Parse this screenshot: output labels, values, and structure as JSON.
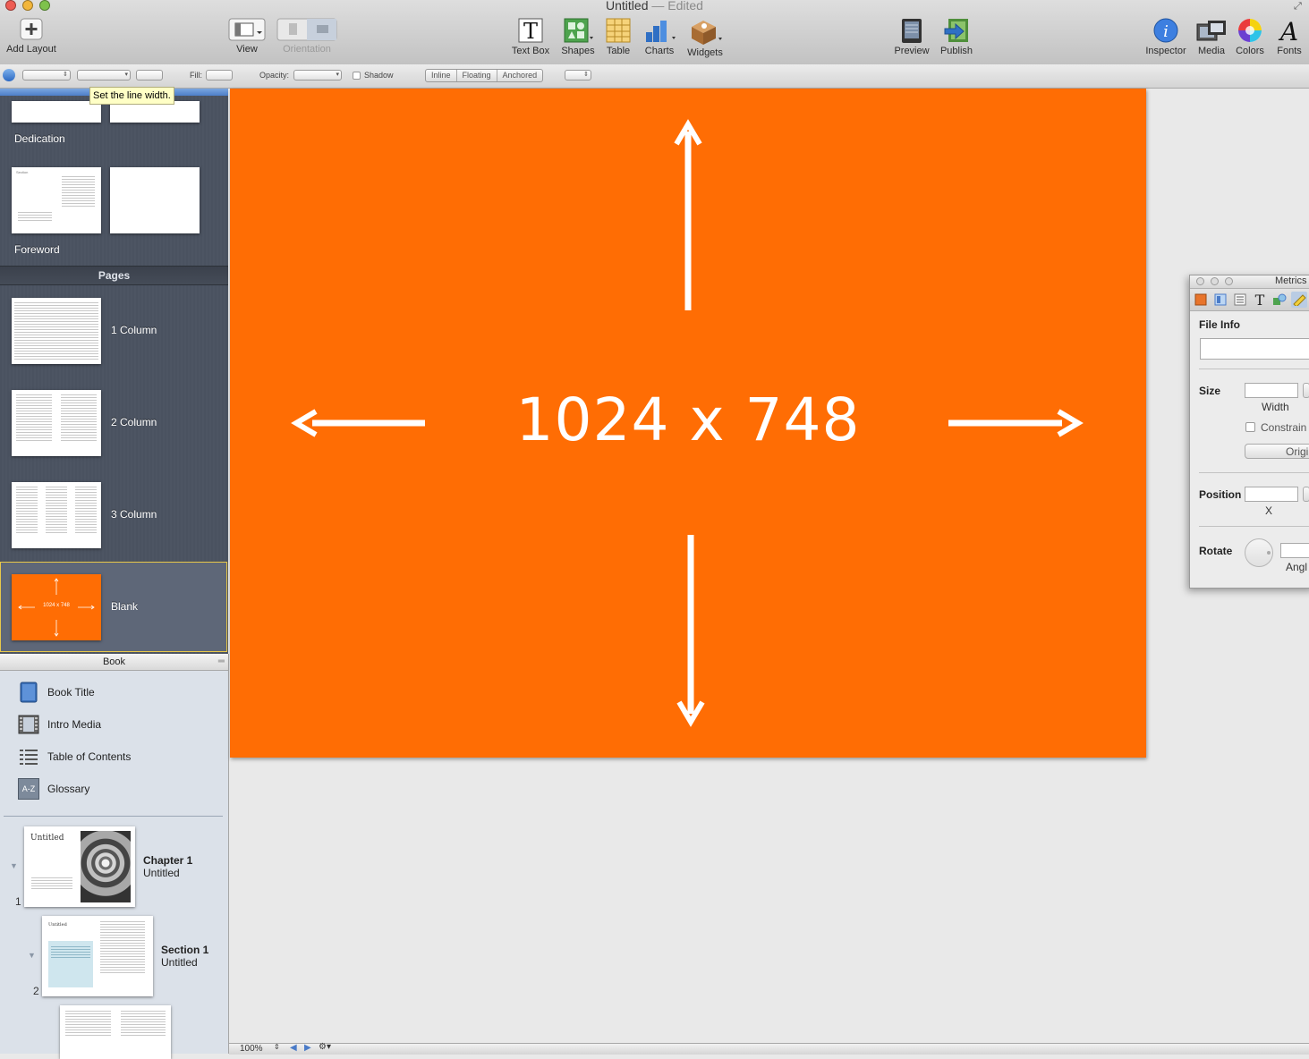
{
  "window": {
    "title": "Untitled",
    "separator": "—",
    "status": "Edited"
  },
  "toolbar": {
    "add_layout": "Add Layout",
    "view": "View",
    "orientation": "Orientation",
    "text_box": "Text Box",
    "shapes": "Shapes",
    "table": "Table",
    "charts": "Charts",
    "widgets": "Widgets",
    "preview": "Preview",
    "publish": "Publish",
    "inspector": "Inspector",
    "media": "Media",
    "colors": "Colors",
    "fonts": "Fonts"
  },
  "format_bar": {
    "fill_label": "Fill:",
    "opacity_label": "Opacity:",
    "shadow_label": "Shadow",
    "wrap_options": [
      "Inline",
      "Floating",
      "Anchored"
    ],
    "tooltip": "Set the line width."
  },
  "layouts": {
    "dedication_label": "Dedication",
    "foreword_label": "Foreword",
    "foreword_thumb_heading": "Section",
    "pages_header": "Pages",
    "pages": [
      "1 Column",
      "2 Column",
      "3 Column",
      "Blank"
    ],
    "blank_thumb_caption": "1024 x 748"
  },
  "book": {
    "header": "Book",
    "items": [
      "Book Title",
      "Intro Media",
      "Table of Contents",
      "Glossary"
    ],
    "glossary_icon_text": "A-Z",
    "chapter": {
      "number": "1",
      "title": "Chapter 1",
      "subtitle": "Untitled",
      "thumb_title": "Untitled"
    },
    "section": {
      "number": "2",
      "title": "Section 1",
      "subtitle": "Untitled",
      "thumb_title": "Untitled"
    }
  },
  "canvas": {
    "caption": "1024 x 748",
    "page_color": "#ff6d04"
  },
  "status_bar": {
    "zoom": "100%"
  },
  "inspector": {
    "title": "Metrics",
    "file_info": "File Info",
    "size": "Size",
    "width_label": "Width",
    "constrain": "Constrain",
    "original_button": "Origi",
    "position": "Position",
    "x_label": "X",
    "rotate": "Rotate",
    "angle_label": "Angl"
  }
}
